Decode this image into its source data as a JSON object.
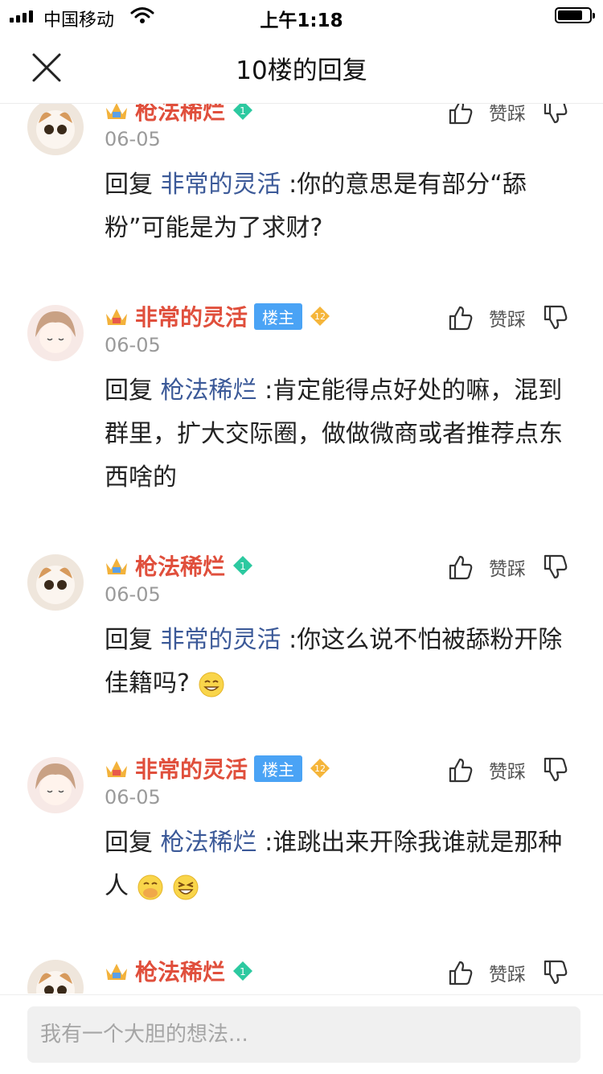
{
  "status_bar": {
    "carrier": "中国移动",
    "time": "上午1:18"
  },
  "nav": {
    "title": "10楼的回复"
  },
  "actions": {
    "like_dislike_label": "赞踩"
  },
  "replies": [
    {
      "user": "枪法稀烂",
      "badge": null,
      "level": "1",
      "level_color": "#2cc9a0",
      "date": "06-05",
      "prefix": "回复",
      "mention": "非常的灵活",
      "text": " :你的意思是有部分“舔粉”可能是为了求财?",
      "emoji": []
    },
    {
      "user": "非常的灵活",
      "badge": "楼主",
      "level": "12",
      "level_color": "#f5b53a",
      "date": "06-05",
      "prefix": "回复",
      "mention": "枪法稀烂",
      "text": " :肯定能得点好处的嘛，混到群里，扩大交际圈，做做微商或者推荐点东西啥的",
      "emoji": []
    },
    {
      "user": "枪法稀烂",
      "badge": null,
      "level": "1",
      "level_color": "#2cc9a0",
      "date": "06-05",
      "prefix": "回复",
      "mention": "非常的灵活",
      "text": " :你这么说不怕被舔粉开除佳籍吗?",
      "emoji": [
        "grin"
      ]
    },
    {
      "user": "非常的灵活",
      "badge": "楼主",
      "level": "12",
      "level_color": "#f5b53a",
      "date": "06-05",
      "prefix": "回复",
      "mention": "枪法稀烂",
      "text": " :谁跳出来开除我谁就是那种人",
      "emoji": [
        "cover-mouth",
        "laugh"
      ]
    },
    {
      "user": "枪法稀烂",
      "badge": null,
      "level": "1",
      "level_color": "#2cc9a0",
      "date": "",
      "prefix": "",
      "mention": "",
      "text": "",
      "emoji": []
    }
  ],
  "input": {
    "placeholder": "我有一个大胆的想法..."
  }
}
